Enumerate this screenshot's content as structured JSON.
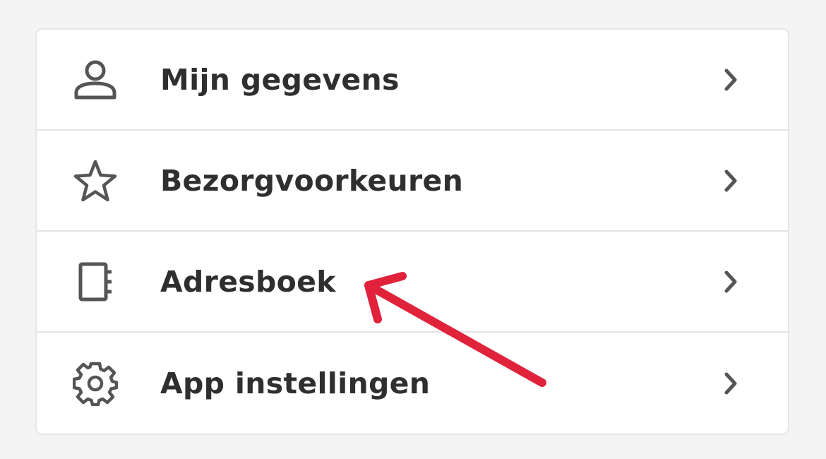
{
  "menu": {
    "items": [
      {
        "label": "Mijn gegevens",
        "icon": "user-icon"
      },
      {
        "label": "Bezorgvoorkeuren",
        "icon": "star-icon"
      },
      {
        "label": "Adresboek",
        "icon": "address-book-icon"
      },
      {
        "label": "App instellingen",
        "icon": "gear-icon"
      }
    ]
  },
  "annotation": {
    "icon": "arrow-icon",
    "color": "#e0223a"
  },
  "colors": {
    "icon": "#555555",
    "text": "#2f2f2f",
    "chevron": "#555555"
  }
}
